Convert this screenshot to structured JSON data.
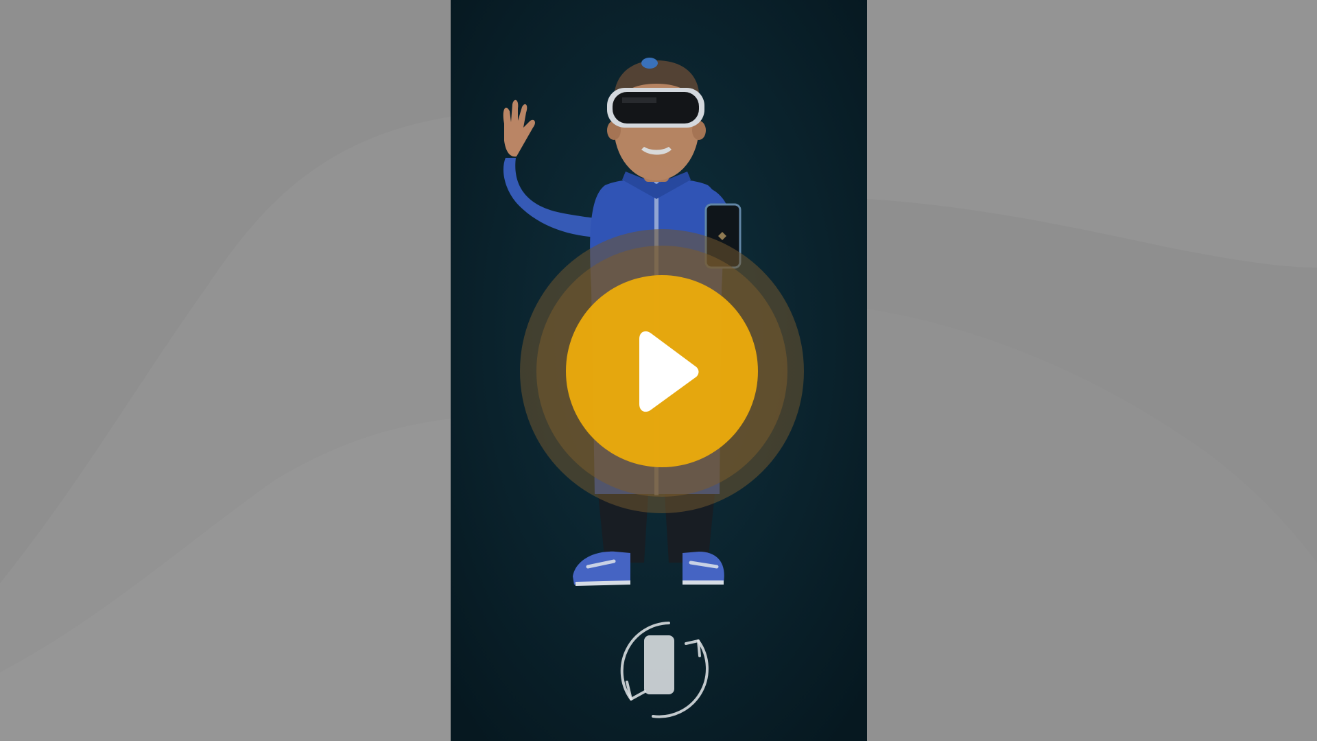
{
  "page": {
    "background_color": "#8f8f8f",
    "video_background_color": "#0b2432"
  },
  "video_player": {
    "state": "paused",
    "orientation": "portrait",
    "play_button": {
      "icon": "play-icon",
      "fill_color": "#e9a90c",
      "ring_color": "#6f5530"
    },
    "rotate_hint": {
      "icon": "rotate-device-icon"
    },
    "illustration": {
      "subject": "vr-headset-character-waving-holding-phone"
    }
  }
}
